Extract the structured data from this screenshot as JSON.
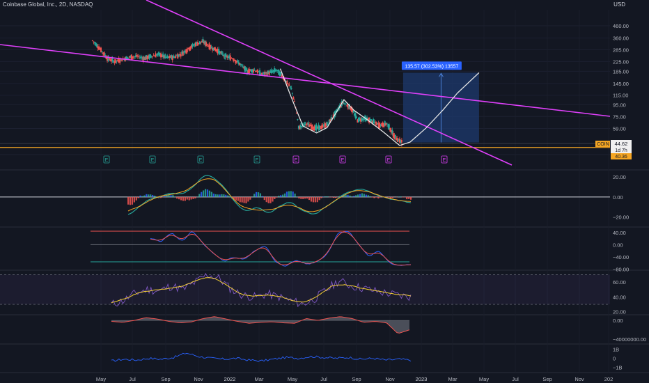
{
  "header": {
    "title": "Coinbase Global, Inc., 2D, NASDAQ",
    "currency": "USD"
  },
  "colors": {
    "background": "#131722",
    "up": "#26a69a",
    "down": "#ef5350",
    "trendline": "#e040fb",
    "support": "#f5a623",
    "projection_box": "#1e3a6e",
    "projection_label": "#2962ff",
    "curve": "#e6e6e6",
    "price_tag": "#f5a623"
  },
  "chart_data": [
    {
      "type": "candlestick",
      "name": "price",
      "y_axis": "log",
      "y_ticks": [
        460,
        360,
        285,
        225,
        185,
        145,
        115,
        95,
        75,
        59,
        35
      ],
      "y_tick_labels": [
        "460.00",
        "360.00",
        "285.00",
        "225.00",
        "185.00",
        "145.00",
        "115.00",
        "95.00",
        "75.00",
        "59.00",
        "35.00"
      ],
      "x_labels": [
        "May",
        "Jul",
        "Sep",
        "Nov",
        "2022",
        "Mar",
        "May",
        "Jul",
        "Sep",
        "Nov",
        "2023",
        "Mar",
        "May",
        "Jul",
        "Sep",
        "Nov",
        "202"
      ],
      "close_series_approx": [
        [
          "2021-04-15",
          342
        ],
        [
          "2021-04-29",
          290
        ],
        [
          "2021-05-13",
          240
        ],
        [
          "2021-05-27",
          225
        ],
        [
          "2021-06-10",
          235
        ],
        [
          "2021-06-24",
          245
        ],
        [
          "2021-07-08",
          250
        ],
        [
          "2021-07-22",
          240
        ],
        [
          "2021-08-05",
          250
        ],
        [
          "2021-08-19",
          260
        ],
        [
          "2021-09-02",
          245
        ],
        [
          "2021-09-16",
          245
        ],
        [
          "2021-09-30",
          260
        ],
        [
          "2021-10-14",
          290
        ],
        [
          "2021-10-28",
          320
        ],
        [
          "2021-11-11",
          335
        ],
        [
          "2021-11-25",
          300
        ],
        [
          "2021-12-09",
          280
        ],
        [
          "2021-12-23",
          250
        ],
        [
          "2022-01-06",
          240
        ],
        [
          "2022-01-20",
          215
        ],
        [
          "2022-02-03",
          185
        ],
        [
          "2022-02-17",
          190
        ],
        [
          "2022-03-03",
          175
        ],
        [
          "2022-03-17",
          180
        ],
        [
          "2022-03-31",
          190
        ],
        [
          "2022-04-14",
          160
        ],
        [
          "2022-04-28",
          130
        ],
        [
          "2022-05-12",
          60
        ],
        [
          "2022-05-26",
          65
        ],
        [
          "2022-06-09",
          60
        ],
        [
          "2022-06-23",
          60
        ],
        [
          "2022-07-07",
          65
        ],
        [
          "2022-07-21",
          80
        ],
        [
          "2022-08-04",
          100
        ],
        [
          "2022-08-18",
          90
        ],
        [
          "2022-09-01",
          70
        ],
        [
          "2022-09-15",
          72
        ],
        [
          "2022-09-29",
          68
        ],
        [
          "2022-10-13",
          63
        ],
        [
          "2022-10-27",
          65
        ],
        [
          "2022-11-10",
          50
        ],
        [
          "2022-11-24",
          44.62
        ]
      ],
      "last_price": "44.62",
      "last_price_countdown": "1d 7h",
      "support_level": 40.36,
      "support_label": "40.36",
      "symbol_tag": "COIN",
      "trendlines": [
        {
          "name": "descending-resistance",
          "color": "#e040fb"
        },
        {
          "name": "long-descending-line",
          "color": "#e040fb"
        }
      ],
      "projection": {
        "label": "135.57 (302.53%) 13557",
        "from_price": 44.62,
        "to_price": 180
      },
      "earnings_markers": [
        "E",
        "E",
        "E",
        "E",
        "E",
        "E",
        "E",
        "E"
      ]
    },
    {
      "type": "histogram",
      "name": "macd",
      "y_ticks": [
        20,
        0,
        -20
      ],
      "y_tick_labels": [
        "20.00",
        "0.00",
        "−20.00"
      ]
    },
    {
      "type": "line",
      "name": "stochastic",
      "y_ticks": [
        40,
        0,
        -40,
        -80
      ],
      "y_tick_labels": [
        "40.00",
        "0.00",
        "−40.00",
        "−80.00"
      ]
    },
    {
      "type": "line",
      "name": "rsi",
      "y_ticks": [
        60,
        40,
        20
      ],
      "y_tick_labels": [
        "60.00",
        "40.00",
        "20.00"
      ]
    },
    {
      "type": "area",
      "name": "oscillator",
      "y_ticks": [
        0,
        -40000000
      ],
      "y_tick_labels": [
        "0.00",
        "−40000000.00"
      ]
    },
    {
      "type": "line",
      "name": "volume-flow",
      "y_ticks": [
        1,
        0,
        -1
      ],
      "y_tick_labels": [
        "1B",
        "0",
        "−1B"
      ]
    }
  ]
}
